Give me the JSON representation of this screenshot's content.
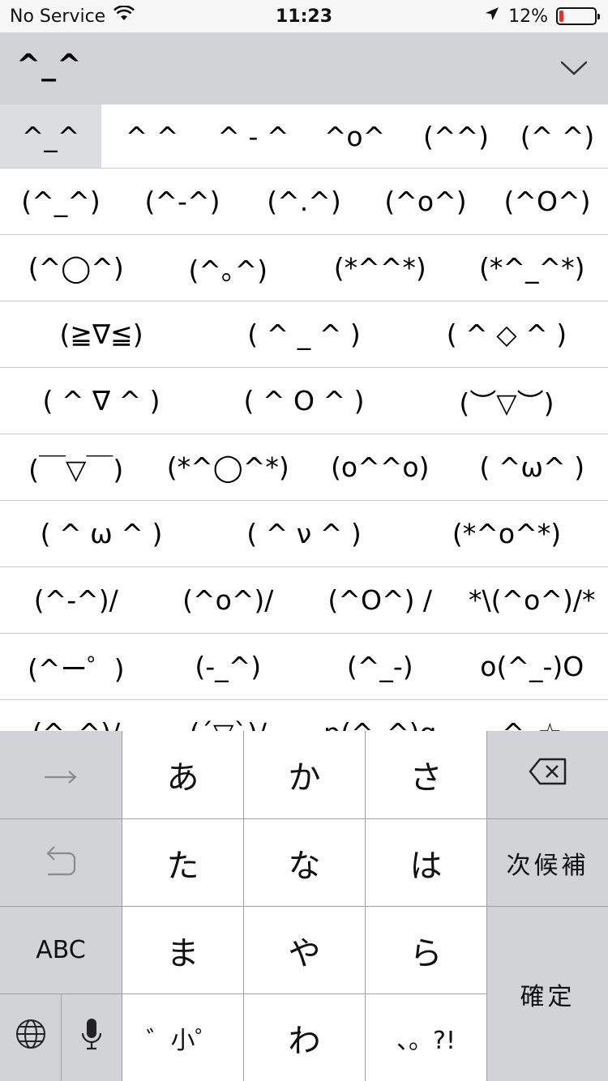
{
  "status_bar": {
    "carrier": "No Service",
    "time": "11:23",
    "battery_percent": "12%",
    "battery_level": 0.12,
    "battery_color": "#e2322b"
  },
  "candidate_header": {
    "current": "^_^",
    "collapse_icon": "chevron-down-icon"
  },
  "candidates": [
    [
      "^_^",
      "^ ^",
      "^ - ^",
      "^o^",
      "(^^)",
      "(^ ^)"
    ],
    [
      "(^_^)",
      "(^-^)",
      "(^.^)",
      "(^o^)",
      "(^O^)"
    ],
    [
      "(^◯^)",
      "(^｡^)",
      "(*^^*)",
      "(*^_^*)"
    ],
    [
      "(≧∇≦)",
      "( ^ _ ^ )",
      "( ^ ◇ ^ )"
    ],
    [
      "( ^ ∇ ^ )",
      "( ^ O ^ )",
      "(︶▽︶)"
    ],
    [
      "(￣▽￣)",
      "(*^◯^*)",
      "(o^^o)",
      "( ^ω^ )"
    ],
    [
      "( ^ ω ^ )",
      "( ^ ν ^ )",
      "(*^o^*)"
    ],
    [
      "(^-^)/",
      "(^o^)/",
      "(^O^) /",
      "*\\(^o^)/*"
    ],
    [
      "(^ー゜)",
      "(-_^)",
      "(^_-)",
      "o(^_-)O"
    ],
    [
      "(^_^)/",
      "(´▽`)/",
      "p(^_^)q",
      "^_☆"
    ]
  ],
  "keyboard": {
    "next_key_icon": "arrow-right-icon",
    "undo_icon": "undo-icon",
    "abc_label": "ABC",
    "globe_icon": "globe-icon",
    "mic_icon": "microphone-icon",
    "delete_icon": "delete-icon",
    "next_candidate_label": "次候補",
    "confirm_label": "確定",
    "kana": {
      "a": "あ",
      "ka": "か",
      "sa": "さ",
      "ta": "た",
      "na": "な",
      "ha": "は",
      "ma": "ま",
      "ya": "や",
      "ra": "ら",
      "dakuten": "゛小゜",
      "wa": "わ",
      "punct": "、。?!"
    }
  }
}
